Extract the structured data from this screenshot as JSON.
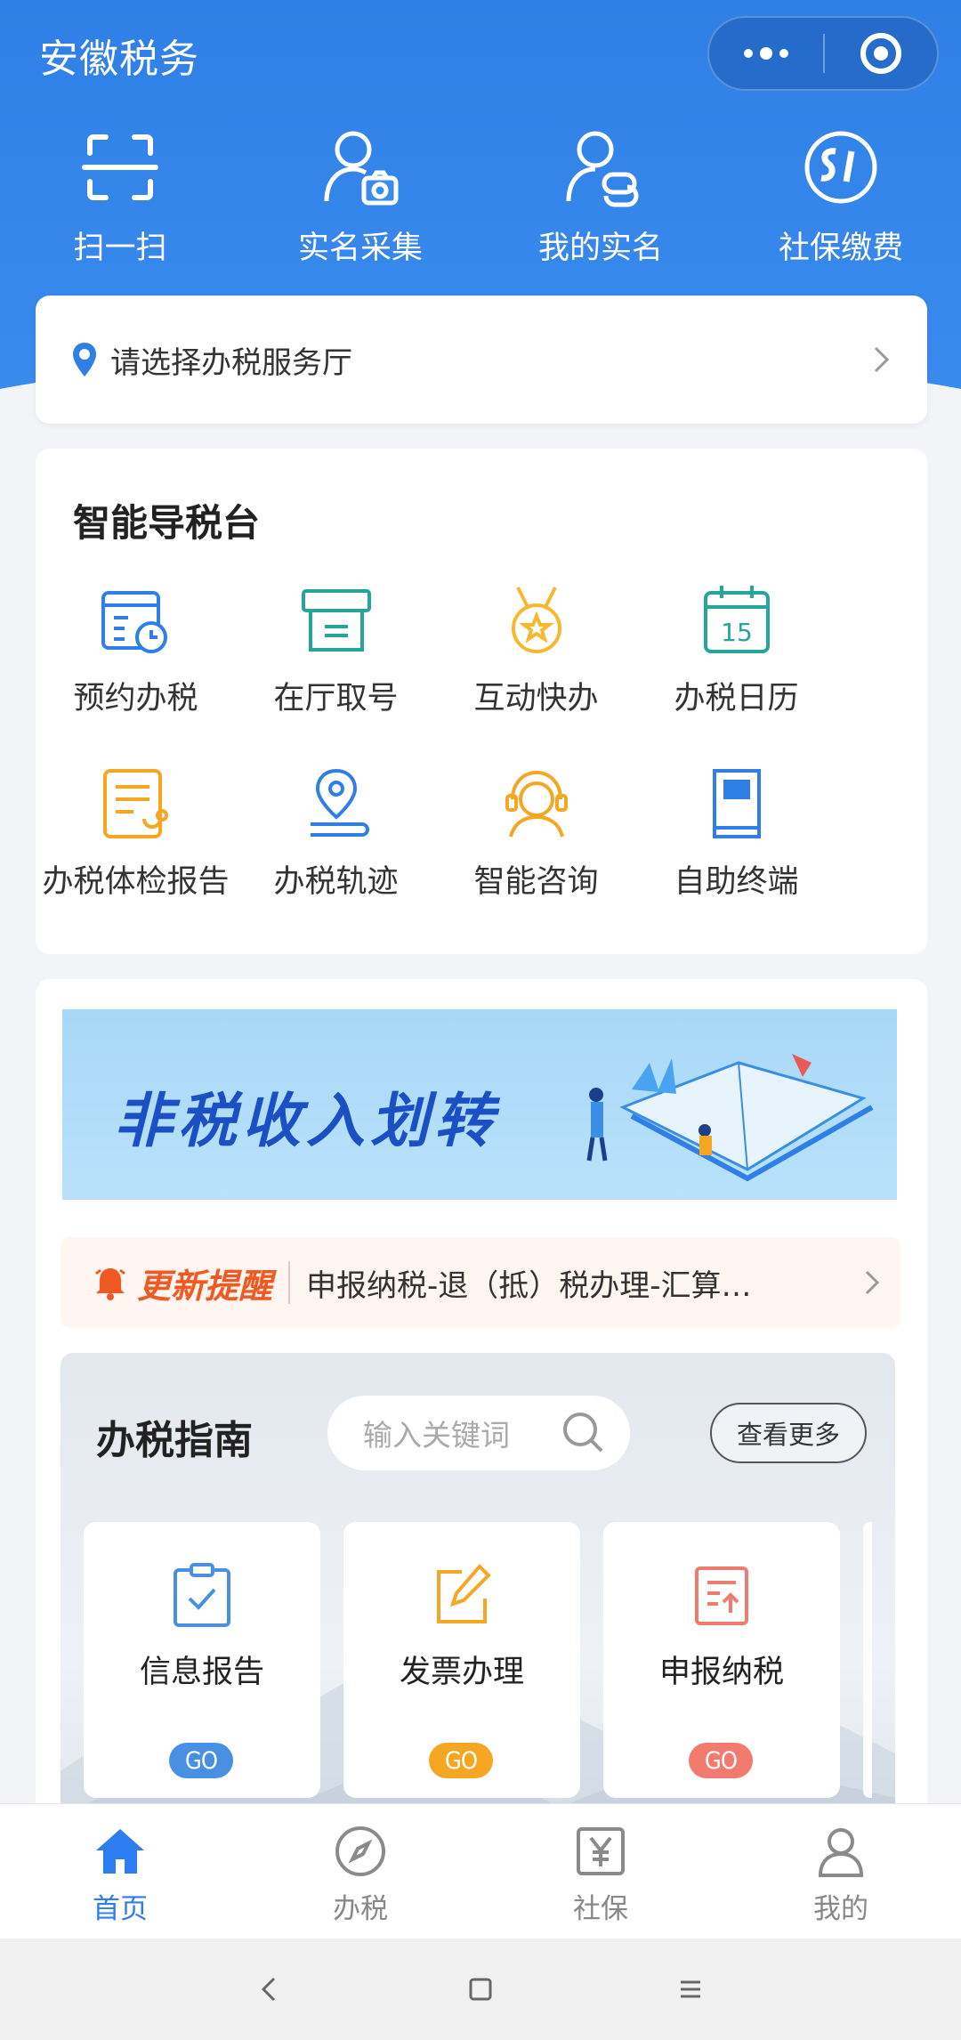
{
  "header": {
    "title": "安徽税务",
    "quick_actions": [
      {
        "label": "扫一扫",
        "icon": "scan-icon"
      },
      {
        "label": "实名采集",
        "icon": "user-camera-icon"
      },
      {
        "label": "我的实名",
        "icon": "user-card-icon"
      },
      {
        "label": "社保缴费",
        "icon": "social-security-icon"
      }
    ]
  },
  "location": {
    "placeholder": "请选择办税服务厅"
  },
  "smart_guide": {
    "title": "智能导税台",
    "items": [
      {
        "label": "预约办税",
        "icon": "calendar-clock-icon"
      },
      {
        "label": "在厅取号",
        "icon": "ticket-icon"
      },
      {
        "label": "互动快办",
        "icon": "medal-icon"
      },
      {
        "label": "办税日历",
        "icon": "calendar-icon"
      },
      {
        "label": "办税体检报告",
        "icon": "report-icon"
      },
      {
        "label": "办税轨迹",
        "icon": "map-pin-icon"
      },
      {
        "label": "智能咨询",
        "icon": "headset-icon"
      },
      {
        "label": "自助终端",
        "icon": "kiosk-icon"
      }
    ]
  },
  "banner": {
    "text": "非税收入划转"
  },
  "notice": {
    "tag": "更新提醒",
    "message": "申报纳税-退（抵）税办理-汇算…"
  },
  "tax_guide": {
    "title": "办税指南",
    "search_placeholder": "输入关键词",
    "more_label": "查看更多",
    "services": [
      {
        "label": "信息报告",
        "go": "GO",
        "color": "#4a90e2"
      },
      {
        "label": "发票办理",
        "go": "GO",
        "color": "#f5a623"
      },
      {
        "label": "申报纳税",
        "go": "GO",
        "color": "#f07b6e"
      }
    ]
  },
  "tabbar": {
    "tabs": [
      {
        "label": "首页",
        "active": true
      },
      {
        "label": "办税",
        "active": false
      },
      {
        "label": "社保",
        "active": false
      },
      {
        "label": "我的",
        "active": false
      }
    ]
  },
  "colors": {
    "primary": "#2f7fe6",
    "active_tab": "#2d7cf0",
    "notice_tag": "#f05a22"
  }
}
